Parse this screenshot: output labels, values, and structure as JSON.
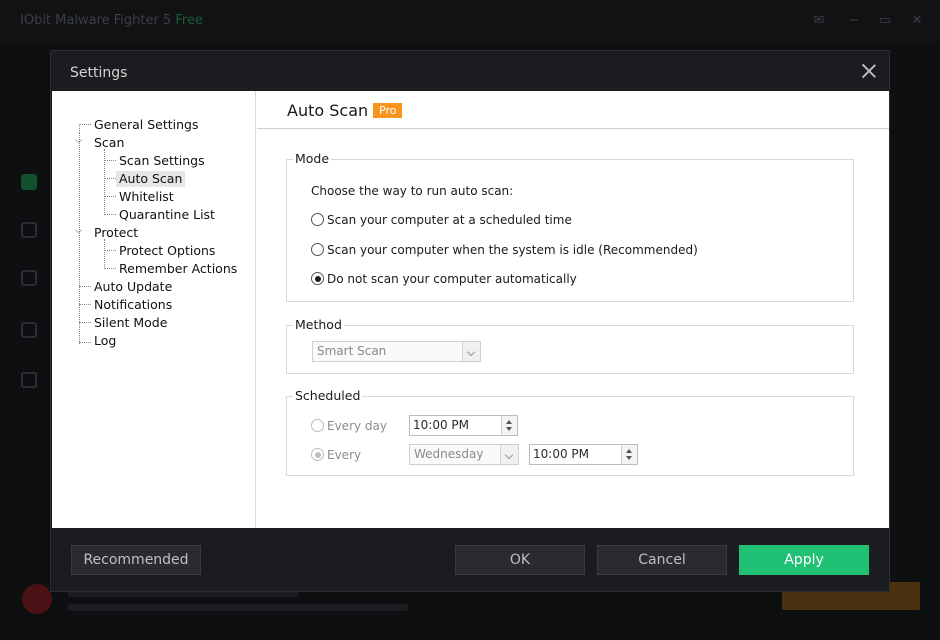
{
  "background_app": {
    "title": "IObit Malware Fighter 5",
    "edition": "Free",
    "window_controls": [
      "feedback-icon",
      "menu-icon",
      "minimize-icon",
      "close-icon"
    ]
  },
  "dialog": {
    "title": "Settings",
    "close_icon": "close-icon"
  },
  "tree": {
    "items": [
      {
        "label": "General Settings"
      },
      {
        "label": "Scan",
        "expanded": true,
        "expander_glyph": "⌵"
      },
      {
        "label": "Scan Settings"
      },
      {
        "label": "Auto Scan",
        "selected": true
      },
      {
        "label": "Whitelist"
      },
      {
        "label": "Quarantine List"
      },
      {
        "label": "Protect",
        "expanded": true,
        "expander_glyph": "⌵"
      },
      {
        "label": "Protect Options"
      },
      {
        "label": "Remember Actions"
      },
      {
        "label": "Auto Update"
      },
      {
        "label": "Notifications"
      },
      {
        "label": "Silent Mode"
      },
      {
        "label": "Log"
      }
    ]
  },
  "content": {
    "title": "Auto Scan",
    "badge": "Pro",
    "badge_color": "#f7941e",
    "mode": {
      "label": "Mode",
      "intro": "Choose the way to run auto scan:",
      "options": [
        {
          "label": "Scan your computer at a scheduled time",
          "checked": false
        },
        {
          "label": "Scan your computer when the system is idle (Recommended)",
          "checked": false
        },
        {
          "label": "Do not scan your computer automatically",
          "checked": true
        }
      ]
    },
    "method": {
      "label": "Method",
      "selected": "Smart Scan"
    },
    "scheduled": {
      "label": "Scheduled",
      "every_day": {
        "label": "Every day",
        "checked": false,
        "time": "10:00 PM"
      },
      "every": {
        "label": "Every",
        "checked": true,
        "day": "Wednesday",
        "time": "10:00 PM"
      }
    }
  },
  "footer": {
    "recommended": "Recommended",
    "ok": "OK",
    "cancel": "Cancel",
    "apply": "Apply",
    "apply_color": "#20c174"
  }
}
